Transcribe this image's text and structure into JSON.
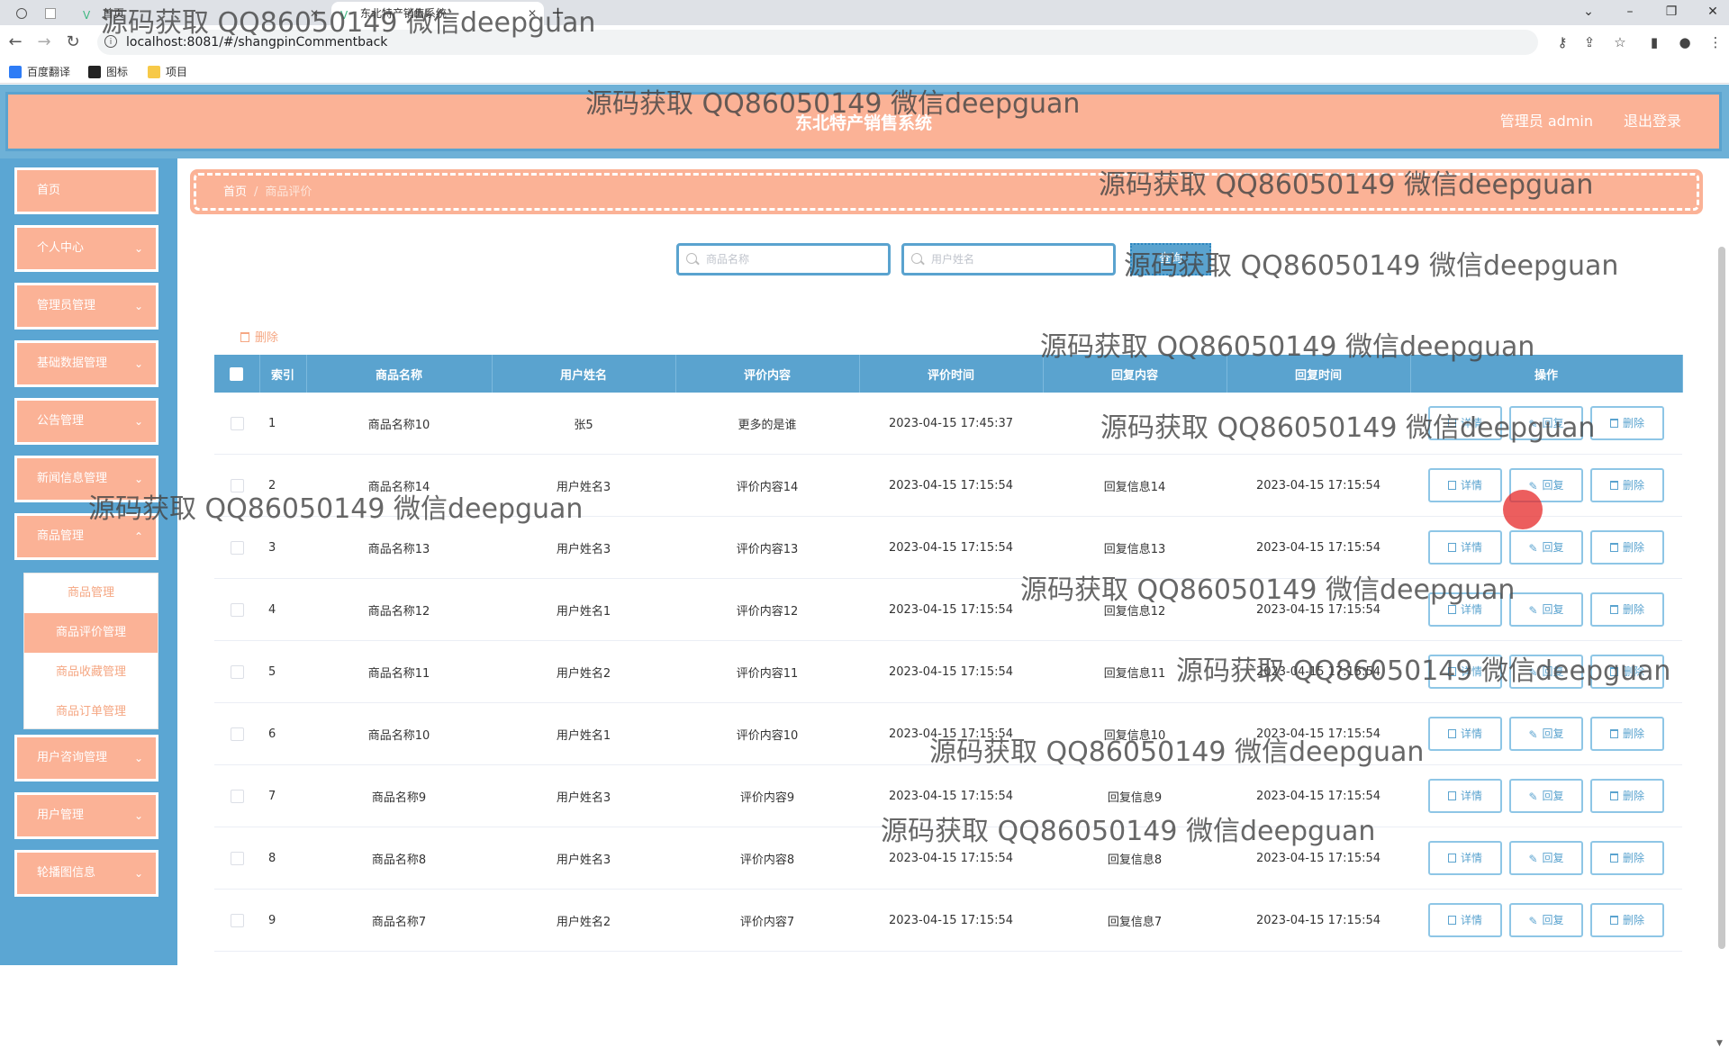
{
  "browser": {
    "tabs": [
      {
        "label": "",
        "active": false
      },
      {
        "label": "",
        "active": false
      },
      {
        "label": "首页",
        "active": false
      },
      {
        "label": "东北特产销售系统",
        "active": true
      }
    ],
    "new_tab": "+",
    "url": "localhost:8081/#/shangpinCommentback",
    "bookmarks": [
      "百度翻译",
      "图标",
      "项目"
    ],
    "controls": {
      "minimize": "–",
      "restore": "❐",
      "close": "✕",
      "tab_list": "⌄"
    }
  },
  "header": {
    "title": "东北特产销售系统",
    "user_label": "管理员 admin",
    "logout_label": "退出登录"
  },
  "sidebar": {
    "items": [
      {
        "label": "首页",
        "has_chevron": false
      },
      {
        "label": "个人中心",
        "has_chevron": true
      },
      {
        "label": "管理员管理",
        "has_chevron": true
      },
      {
        "label": "基础数据管理",
        "has_chevron": true
      },
      {
        "label": "公告管理",
        "has_chevron": true
      },
      {
        "label": "新闻信息管理",
        "has_chevron": true
      },
      {
        "label": "商品管理",
        "has_chevron": true
      },
      {
        "label": "用户咨询管理",
        "has_chevron": true
      },
      {
        "label": "用户管理",
        "has_chevron": true
      },
      {
        "label": "轮播图信息",
        "has_chevron": true
      }
    ],
    "submenu": [
      "商品管理",
      "商品评价管理",
      "商品收藏管理",
      "商品订单管理"
    ],
    "submenu_active": 1
  },
  "breadcrumb": {
    "home": "首页",
    "separator": "/",
    "current": "商品评价"
  },
  "search": {
    "product_placeholder": "商品名称",
    "user_placeholder": "用户姓名",
    "query_label": "查询"
  },
  "bulk_delete_label": "删除",
  "table": {
    "columns": [
      "索引",
      "商品名称",
      "用户姓名",
      "评价内容",
      "评价时间",
      "回复内容",
      "回复时间",
      "操作"
    ],
    "rows": [
      {
        "index": "1",
        "product": "商品名称10",
        "user": "张5",
        "content": "更多的是谁",
        "time": "2023-04-15 17:45:37",
        "reply": "",
        "reply_time": ""
      },
      {
        "index": "2",
        "product": "商品名称14",
        "user": "用户姓名3",
        "content": "评价内容14",
        "time": "2023-04-15 17:15:54",
        "reply": "回复信息14",
        "reply_time": "2023-04-15 17:15:54"
      },
      {
        "index": "3",
        "product": "商品名称13",
        "user": "用户姓名3",
        "content": "评价内容13",
        "time": "2023-04-15 17:15:54",
        "reply": "回复信息13",
        "reply_time": "2023-04-15 17:15:54"
      },
      {
        "index": "4",
        "product": "商品名称12",
        "user": "用户姓名1",
        "content": "评价内容12",
        "time": "2023-04-15 17:15:54",
        "reply": "回复信息12",
        "reply_time": "2023-04-15 17:15:54"
      },
      {
        "index": "5",
        "product": "商品名称11",
        "user": "用户姓名2",
        "content": "评价内容11",
        "time": "2023-04-15 17:15:54",
        "reply": "回复信息11",
        "reply_time": "2023-04-15 17:15:54"
      },
      {
        "index": "6",
        "product": "商品名称10",
        "user": "用户姓名1",
        "content": "评价内容10",
        "time": "2023-04-15 17:15:54",
        "reply": "回复信息10",
        "reply_time": "2023-04-15 17:15:54"
      },
      {
        "index": "7",
        "product": "商品名称9",
        "user": "用户姓名3",
        "content": "评价内容9",
        "time": "2023-04-15 17:15:54",
        "reply": "回复信息9",
        "reply_time": "2023-04-15 17:15:54"
      },
      {
        "index": "8",
        "product": "商品名称8",
        "user": "用户姓名3",
        "content": "评价内容8",
        "time": "2023-04-15 17:15:54",
        "reply": "回复信息8",
        "reply_time": "2023-04-15 17:15:54"
      },
      {
        "index": "9",
        "product": "商品名称7",
        "user": "用户姓名2",
        "content": "评价内容7",
        "time": "2023-04-15 17:15:54",
        "reply": "回复信息7",
        "reply_time": "2023-04-15 17:15:54"
      }
    ],
    "actions": {
      "detail": "详情",
      "reply": "回复",
      "delete": "删除"
    }
  },
  "watermark": "源码获取 QQ86050149 微信deepguan",
  "colors": {
    "accent": "#fbb296",
    "primary": "#5aa3cf",
    "sidebar": "#5ba6d3"
  }
}
